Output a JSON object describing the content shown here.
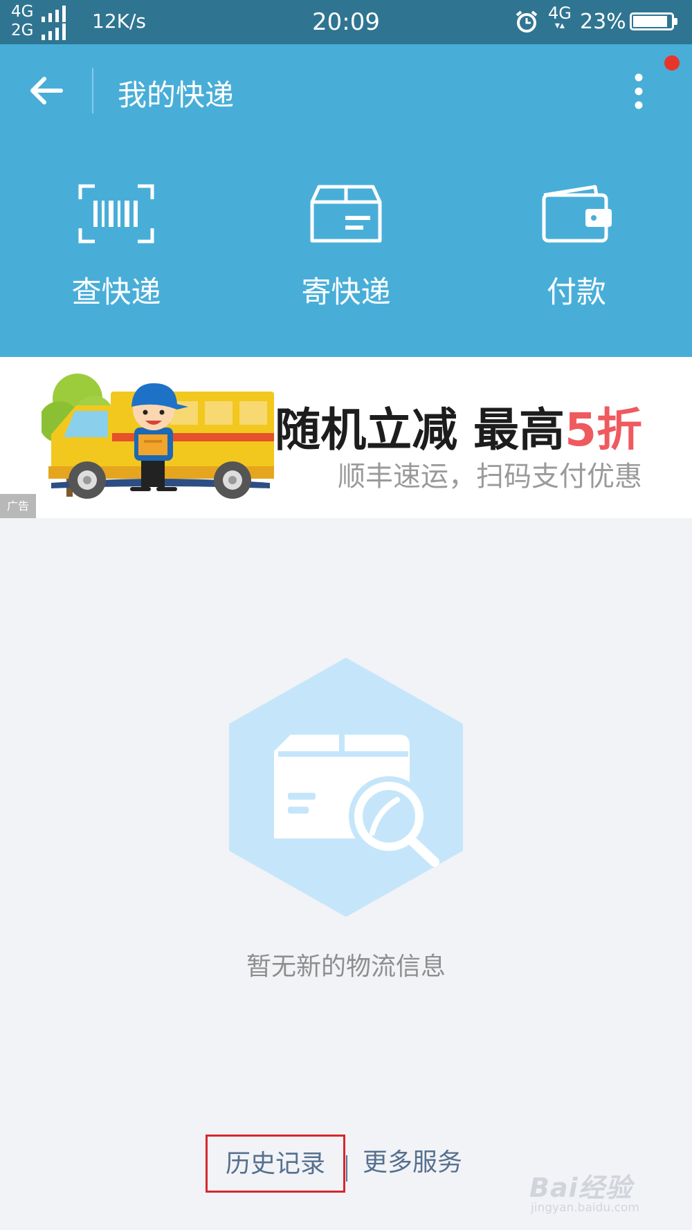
{
  "status_bar": {
    "network_top": "4G",
    "network_bottom": "2G",
    "speed": "12K/s",
    "time": "20:09",
    "network_right": "4G",
    "battery_percent": "23%",
    "battery_level": 0.9,
    "icons": [
      "signal-icon",
      "alarm-icon",
      "battery-icon"
    ]
  },
  "header": {
    "title": "我的快递",
    "background": "#48aed8",
    "icons": [
      "back-arrow-icon",
      "more-options-icon",
      "notification-dot"
    ]
  },
  "actions": [
    {
      "label": "查快递",
      "icon": "barcode-scan-icon"
    },
    {
      "label": "寄快递",
      "icon": "package-box-icon"
    },
    {
      "label": "付款",
      "icon": "wallet-icon"
    }
  ],
  "banner": {
    "headline_part1": "随机立减 最高",
    "headline_highlight": "5折",
    "subline": "顺丰速运，扫码支付优惠",
    "ad_label": "广告",
    "highlight_color": "#ef5a5f",
    "illustration": "delivery-truck-courier-image"
  },
  "empty_state": {
    "message": "暂无新的物流信息",
    "icon": "package-search-icon"
  },
  "footer": {
    "history_label": "历史记录",
    "more_services_label": "更多服务",
    "highlight_border": "#d8262a"
  },
  "watermark": {
    "brand": "Bai经验",
    "url": "jingyan.baidu.com"
  }
}
